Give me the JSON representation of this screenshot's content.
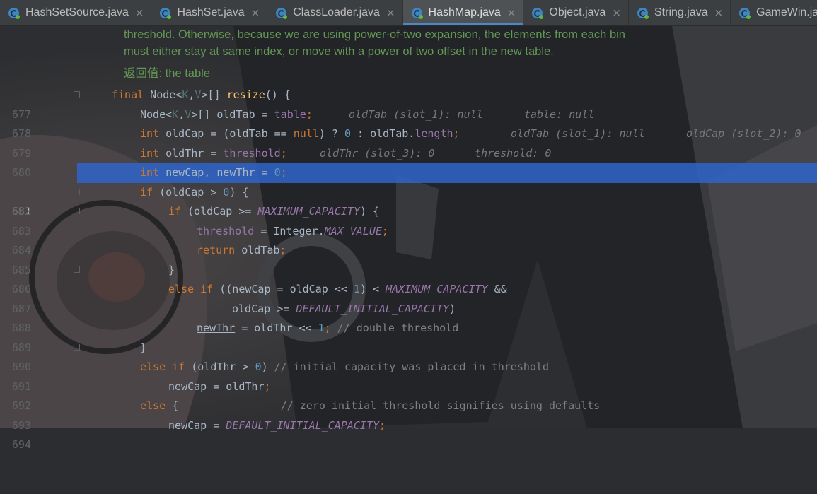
{
  "tabs": [
    {
      "label": "HashSetSource.java",
      "active": false
    },
    {
      "label": "HashSet.java",
      "active": false
    },
    {
      "label": "ClassLoader.java",
      "active": false
    },
    {
      "label": "HashMap.java",
      "active": true
    },
    {
      "label": "Object.java",
      "active": false
    },
    {
      "label": "String.java",
      "active": false
    },
    {
      "label": "GameWin.java",
      "active": false
    }
  ],
  "close_glyph": "×",
  "doc_comment": {
    "line1": "threshold. Otherwise, because we are using power-of-two expansion, the elements from each bin",
    "line2": "must either stay at same index, or move with a power of two offset in the new table.",
    "returns_label": "返回值:",
    "returns_text": " the table"
  },
  "current_line": "681",
  "code": {
    "l677": {
      "n": "677",
      "t1": "final",
      "t2": " Node<",
      "t3": "K",
      "t4": ",",
      "t5": "V",
      "t6": ">[] ",
      "t7": "resize",
      "t8": "() {"
    },
    "l678": {
      "n": "678",
      "t1": "Node<",
      "t2": "K",
      "t3": ",",
      "t4": "V",
      "t5": ">[] oldTab = ",
      "t6": "table",
      "t7": ";",
      "h1": "oldTab (slot_1): null",
      "h2": "table: null"
    },
    "l679": {
      "n": "679",
      "t1": "int",
      "t2": " oldCap = (oldTab == ",
      "t3": "null",
      "t4": ") ? ",
      "t5": "0",
      "t6": " : oldTab.",
      "t7": "length",
      "t8": ";",
      "h1": "oldTab (slot_1): null",
      "h2": "oldCap (slot_2): 0"
    },
    "l680": {
      "n": "680",
      "t1": "int",
      "t2": " oldThr = ",
      "t3": "threshold",
      "t4": ";",
      "h1": "oldThr (slot_3): 0",
      "h2": "threshold: 0"
    },
    "l681": {
      "n": "681",
      "t1": "int",
      "t2": " newCap, ",
      "t3": "newThr",
      "t4": " = ",
      "t5": "0",
      "t6": ";"
    },
    "l682": {
      "n": "682",
      "t1": "if",
      "t2": " (oldCap > ",
      "t3": "0",
      "t4": ") {"
    },
    "l683": {
      "n": "683",
      "t1": "if",
      "t2": " (oldCap >= ",
      "t3": "MAXIMUM_CAPACITY",
      "t4": ") {"
    },
    "l684": {
      "n": "684",
      "t1": "threshold",
      "t2": " = Integer.",
      "t3": "MAX_VALUE",
      "t4": ";"
    },
    "l685": {
      "n": "685",
      "t1": "return",
      "t2": " oldTab",
      "t3": ";"
    },
    "l686": {
      "n": "686",
      "t1": "}"
    },
    "l687": {
      "n": "687",
      "t1": "else if",
      "t2": " ((newCap = oldCap << ",
      "t3": "1",
      "t4": ") < ",
      "t5": "MAXIMUM_CAPACITY",
      "t6": " &&"
    },
    "l688": {
      "n": "688",
      "t1": "oldCap >= ",
      "t2": "DEFAULT_INITIAL_CAPACITY",
      "t3": ")"
    },
    "l689": {
      "n": "689",
      "t1": "newThr",
      "t2": " = oldThr << ",
      "t3": "1",
      "t4": ";",
      "t5": " // double threshold"
    },
    "l690": {
      "n": "690",
      "t1": "}"
    },
    "l691": {
      "n": "691",
      "t1": "else if",
      "t2": " (oldThr > ",
      "t3": "0",
      "t4": ")",
      "t5": " // initial capacity was placed in threshold"
    },
    "l692": {
      "n": "692",
      "t1": "newCap = oldThr",
      "t2": ";"
    },
    "l693": {
      "n": "693",
      "t1": "else",
      "t2": " {",
      "t3": "                // zero initial threshold signifies using defaults"
    },
    "l694": {
      "n": "694",
      "t1": "newCap = ",
      "t2": "DEFAULT_INITIAL_CAPACITY",
      "t3": ";"
    }
  },
  "colors": {
    "background": "#2b2d30",
    "keyword": "#cc7832",
    "method": "#ffc66d",
    "field": "#9876aa",
    "number": "#6897bb",
    "comment": "#808080",
    "doc_comment": "#629755",
    "selection": "#2f65ca",
    "tab_accent": "#4a88c7"
  },
  "icons": {
    "tab": "java-class-icon",
    "close": "close-icon"
  }
}
